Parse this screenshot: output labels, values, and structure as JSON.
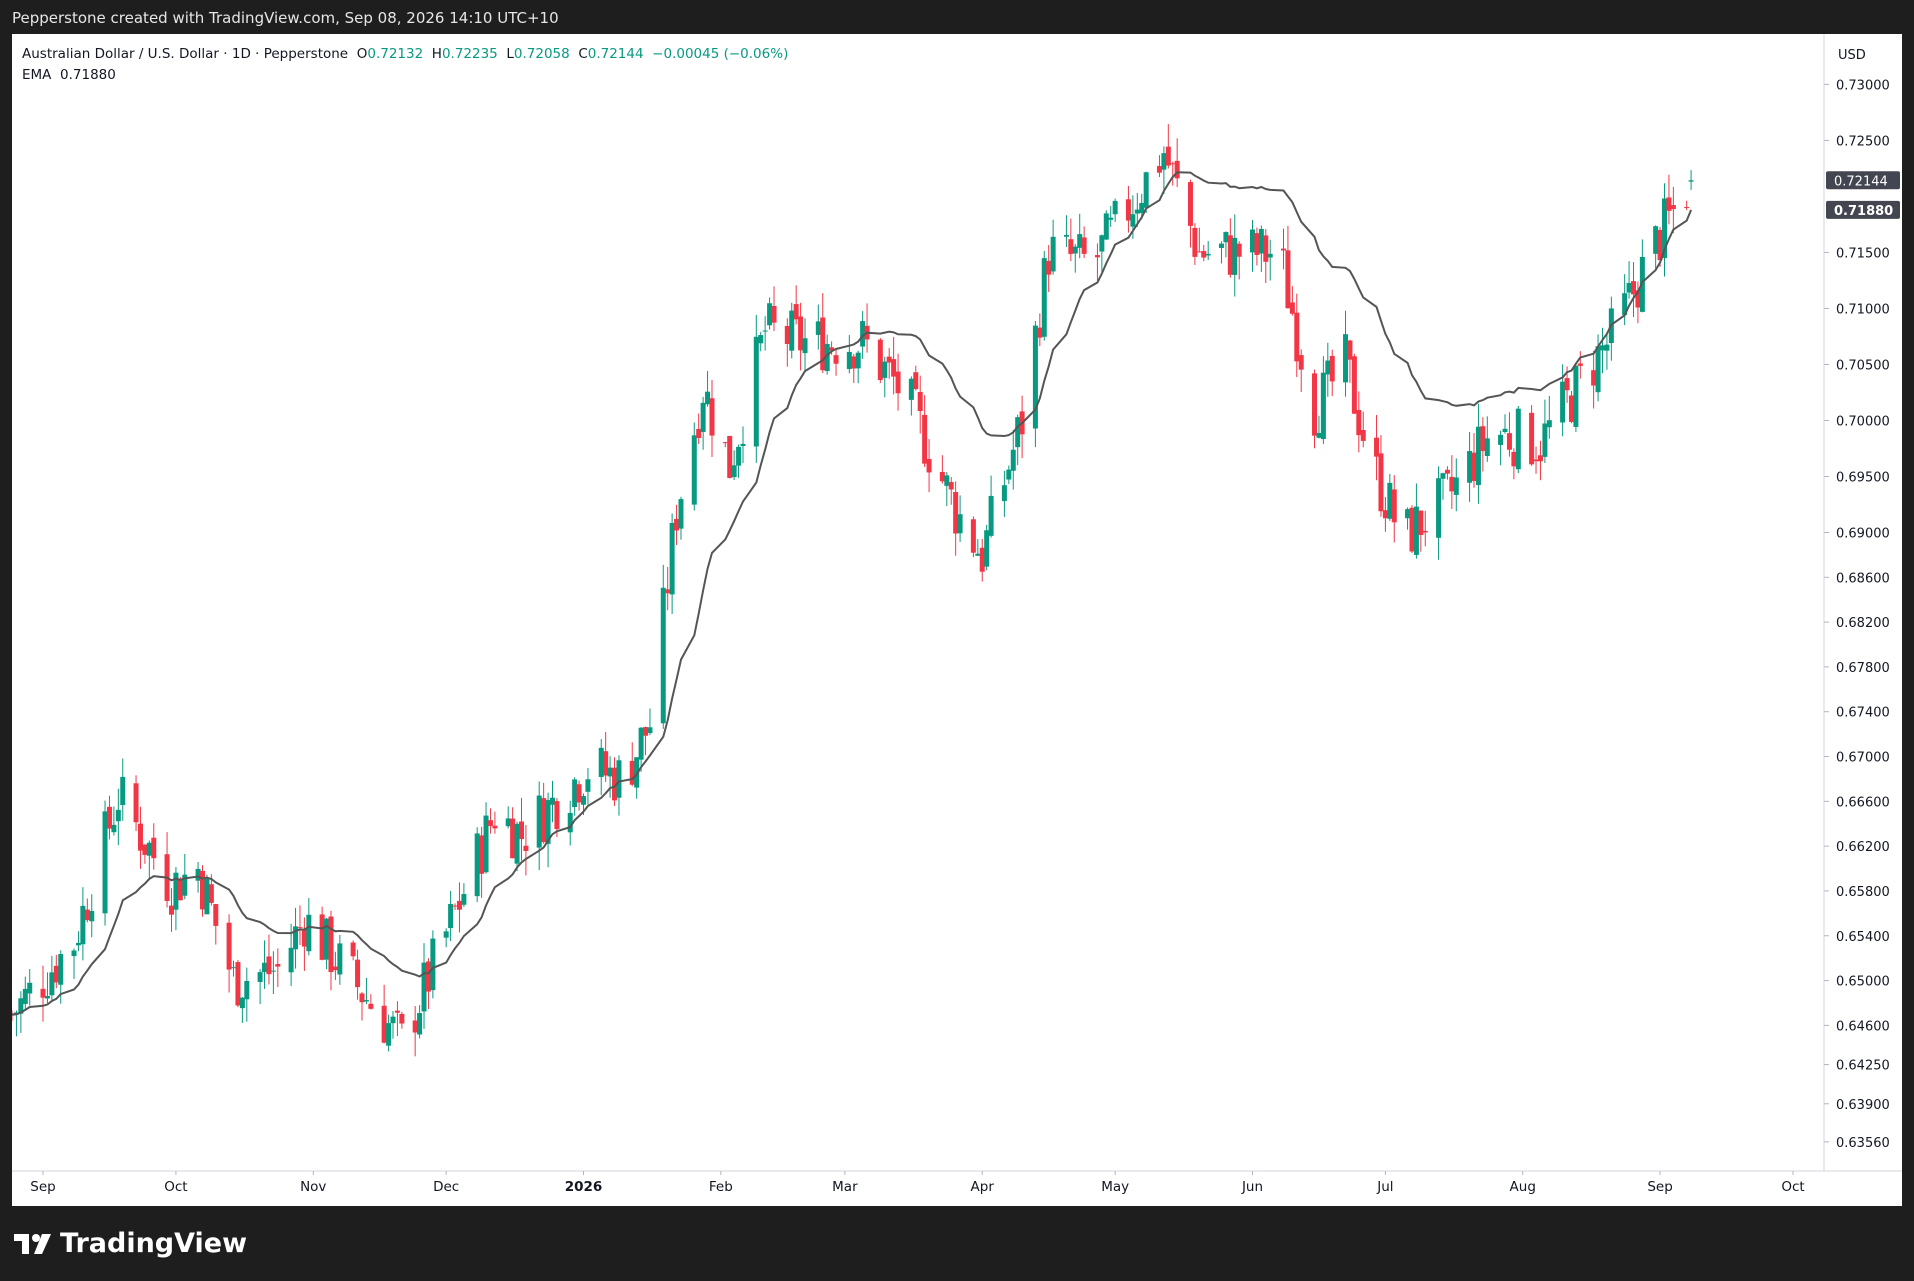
{
  "header": {
    "attribution": "Pepperstone created with TradingView.com, Sep 08, 2026 14:10 UTC+10"
  },
  "legend": {
    "symbol": "Australian Dollar / U.S. Dollar · 1D · Pepperstone",
    "open_label": "O",
    "open": "0.72132",
    "high_label": "H",
    "high": "0.72235",
    "low_label": "L",
    "low": "0.72058",
    "close_label": "C",
    "close": "0.72144",
    "change": "−0.00045 (−0.06%)",
    "ema_label": "EMA",
    "ema_value": "0.71880"
  },
  "price_axis": {
    "currency": "USD",
    "ticks": [
      "0.73000",
      "0.72500",
      "0.71500",
      "0.71000",
      "0.70500",
      "0.70000",
      "0.69500",
      "0.69000",
      "0.68600",
      "0.68200",
      "0.67800",
      "0.67400",
      "0.67000",
      "0.66600",
      "0.66200",
      "0.65800",
      "0.65400",
      "0.65000",
      "0.64600",
      "0.64250",
      "0.63900",
      "0.63560"
    ],
    "last_price_label": "0.72144",
    "ema_price_label": "0.71880"
  },
  "time_axis": {
    "labels": [
      "Sep",
      "Oct",
      "Nov",
      "Dec",
      "2026",
      "Feb",
      "Mar",
      "Apr",
      "May",
      "Jun",
      "Jul",
      "Aug",
      "Sep",
      "Oct"
    ]
  },
  "brand": {
    "name": "TradingView"
  },
  "colors": {
    "up": "#089981",
    "down": "#f23645",
    "ema": "#555555",
    "last_price_bg": "#434651",
    "ema_label_bg": "#434651"
  },
  "chart_data": {
    "type": "candlestick",
    "title": "Australian Dollar / U.S. Dollar · 1D · Pepperstone",
    "ylabel": "USD",
    "ylim": [
      0.633,
      0.7345
    ],
    "x_range": [
      "2025-08-25",
      "2026-10-08"
    ],
    "series": [
      {
        "name": "AUD/USD daily",
        "anchors": [
          [
            "2025-08-25",
            0.647
          ],
          [
            "2025-09-08",
            0.6535
          ],
          [
            "2025-09-18",
            0.6665
          ],
          [
            "2025-09-30",
            0.6585
          ],
          [
            "2025-10-06",
            0.66
          ],
          [
            "2025-10-14",
            0.65
          ],
          [
            "2025-10-24",
            0.651
          ],
          [
            "2025-10-30",
            0.6555
          ],
          [
            "2025-11-10",
            0.65
          ],
          [
            "2025-11-21",
            0.6445
          ],
          [
            "2025-12-03",
            0.656
          ],
          [
            "2025-12-12",
            0.665
          ],
          [
            "2025-12-18",
            0.663
          ],
          [
            "2026-01-02",
            0.669
          ],
          [
            "2026-01-10",
            0.668
          ],
          [
            "2026-01-16",
            0.673
          ],
          [
            "2026-01-22",
            0.692
          ],
          [
            "2026-01-28",
            0.703
          ],
          [
            "2026-02-03",
            0.696
          ],
          [
            "2026-02-11",
            0.708
          ],
          [
            "2026-02-20",
            0.707
          ],
          [
            "2026-03-05",
            0.707
          ],
          [
            "2026-03-15",
            0.702
          ],
          [
            "2026-03-26",
            0.692
          ],
          [
            "2026-04-01",
            0.688
          ],
          [
            "2026-04-10",
            0.7
          ],
          [
            "2026-04-16",
            0.715
          ],
          [
            "2026-04-26",
            0.714
          ],
          [
            "2026-05-04",
            0.719
          ],
          [
            "2026-05-12",
            0.724
          ],
          [
            "2026-05-20",
            0.715
          ],
          [
            "2026-05-29",
            0.715
          ],
          [
            "2026-06-07",
            0.715
          ],
          [
            "2026-06-15",
            0.701
          ],
          [
            "2026-06-22",
            0.705
          ],
          [
            "2026-06-28",
            0.696
          ],
          [
            "2026-07-05",
            0.6895
          ],
          [
            "2026-07-15",
            0.693
          ],
          [
            "2026-07-25",
            0.699
          ],
          [
            "2026-08-05",
            0.698
          ],
          [
            "2026-08-15",
            0.704
          ],
          [
            "2026-08-22",
            0.708
          ],
          [
            "2026-08-30",
            0.715
          ],
          [
            "2026-09-08",
            0.72144
          ]
        ]
      },
      {
        "name": "EMA",
        "last_value": 0.7188
      }
    ],
    "last_bar": {
      "date": "2026-09-08",
      "open": 0.72132,
      "high": 0.72235,
      "low": 0.72058,
      "close": 0.72144
    },
    "grid": false,
    "legend_position": "top-left"
  }
}
